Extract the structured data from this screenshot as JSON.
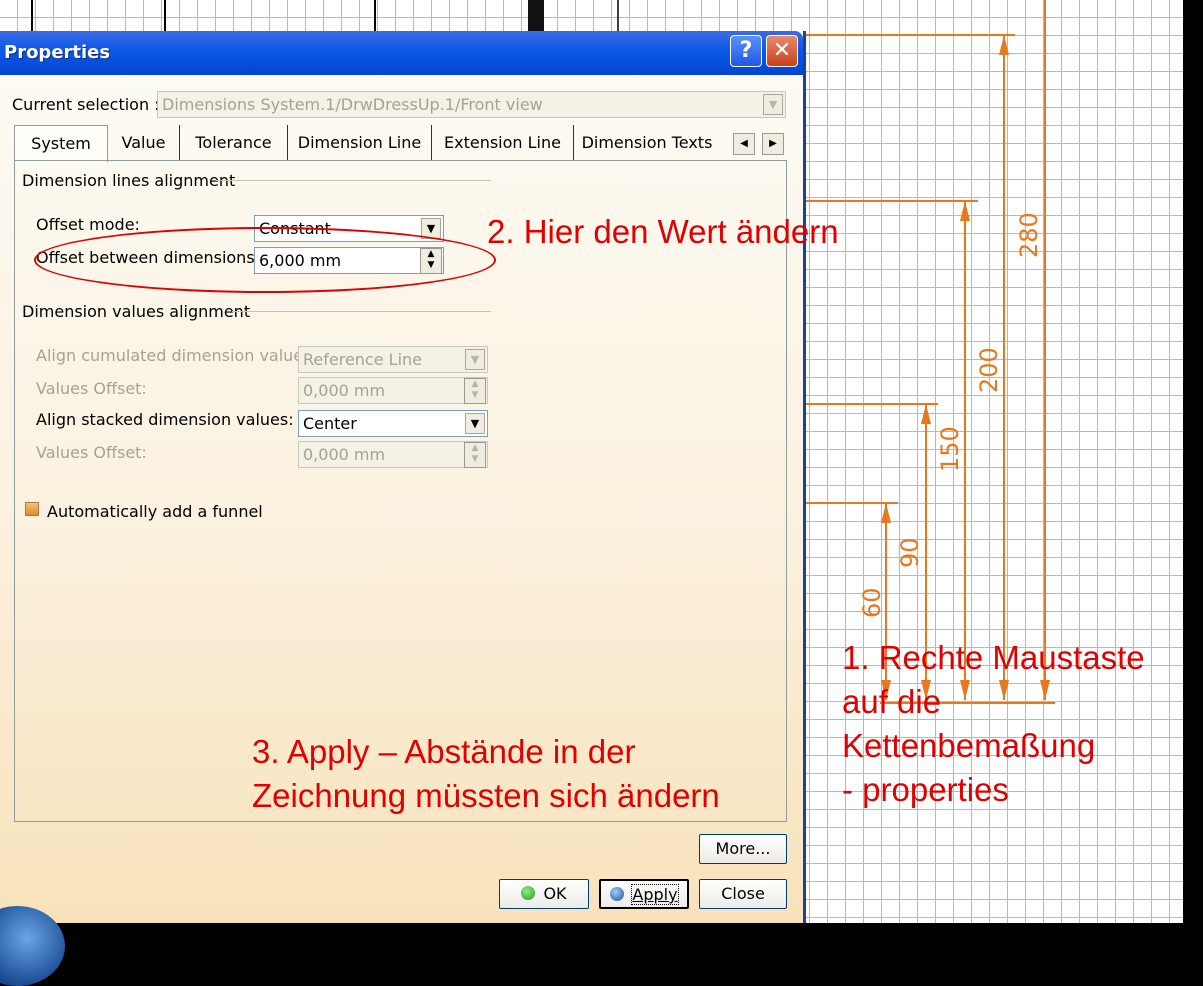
{
  "drawing": {
    "dimensions": [
      "280",
      "200",
      "150",
      "90",
      "60"
    ],
    "dim_color": "#e8781e"
  },
  "dialog": {
    "title": "Properties",
    "help_label": "?",
    "close_label": "✕",
    "current_selection_label": "Current selection :",
    "current_selection_value": "Dimensions System.1/DrwDressUp.1/Front view",
    "tabs": [
      "System",
      "Value",
      "Tolerance",
      "Dimension Line",
      "Extension Line",
      "Dimension Texts"
    ],
    "active_tab": "System",
    "group1_title": "Dimension lines alignment",
    "offset_mode_label": "Offset mode:",
    "offset_mode_value": "Constant",
    "offset_between_label": "Offset between dimensions:",
    "offset_between_value": "6,000 mm",
    "group2_title": "Dimension values alignment",
    "align_cumulated_label": "Align cumulated dimension values:",
    "align_cumulated_value": "Reference Line",
    "values_offset1_label": "Values Offset:",
    "values_offset1_value": "0,000 mm",
    "align_stacked_label": "Align stacked dimension values:",
    "align_stacked_value": "Center",
    "values_offset2_label": "Values Offset:",
    "values_offset2_value": "0,000 mm",
    "funnel_label": "Automatically add a funnel",
    "more_label": "More...",
    "ok_label": "OK",
    "apply_label": "Apply",
    "close_button_label": "Close"
  },
  "annotations": {
    "step1": "1. Rechte Maustaste\nauf die\nKettenbemaßung\n- properties",
    "step2": "2. Hier den Wert ändern",
    "step3": "3. Apply – Abstände in der\nZeichnung müssten sich ändern",
    "color": "#e00000"
  },
  "colors": {
    "titlebar": "#0a58e8",
    "dialog_bg": "#fbf1df",
    "accent_orange": "#e8781e"
  }
}
